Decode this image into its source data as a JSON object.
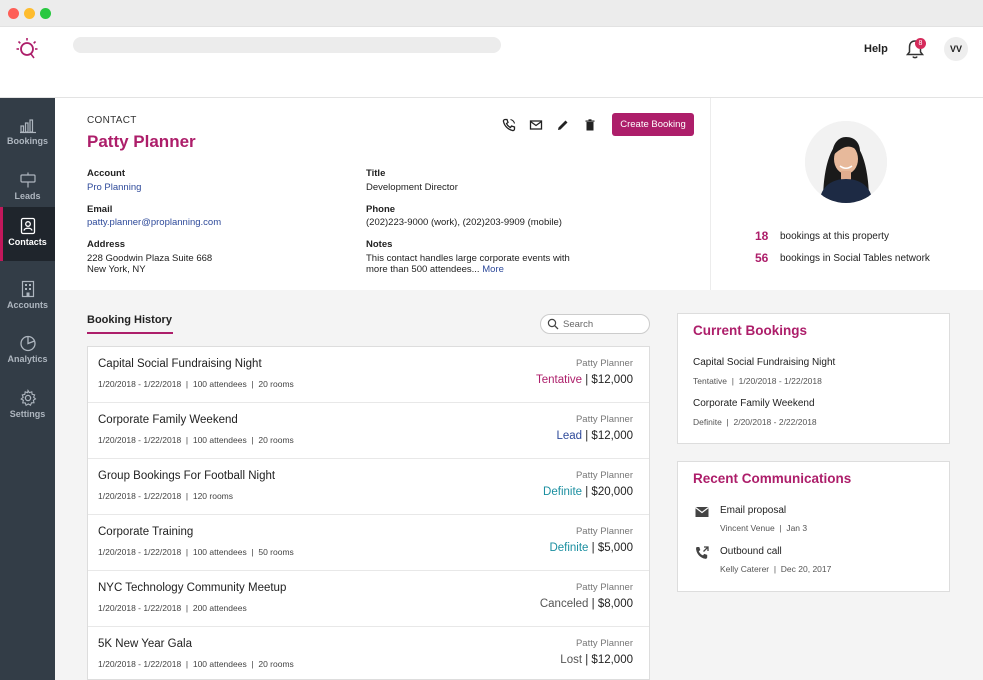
{
  "topbar": {
    "help": "Help",
    "notif_count": "8",
    "avatar_initials": "VV"
  },
  "sidebar": {
    "items": [
      {
        "label": "Bookings",
        "icon": "bar-chart-icon"
      },
      {
        "label": "Leads",
        "icon": "sign-icon"
      },
      {
        "label": "Contacts",
        "icon": "contact-card-icon",
        "active": true
      },
      {
        "label": "Accounts",
        "icon": "building-icon"
      },
      {
        "label": "Analytics",
        "icon": "pie-chart-icon"
      },
      {
        "label": "Settings",
        "icon": "gear-icon"
      }
    ]
  },
  "contact": {
    "kind": "CONTACT",
    "name": "Patty Planner",
    "create_label": "Create Booking",
    "account_label": "Account",
    "account": "Pro Planning",
    "title_label": "Title",
    "title": "Development Director",
    "email_label": "Email",
    "email": "patty.planner@proplanning.com",
    "phone_label": "Phone",
    "phone": "(202)223-9000 (work), (202)203-9909 (mobile)",
    "address_label": "Address",
    "address_line1": "228 Goodwin Plaza Suite 668",
    "address_line2": "New York, NY",
    "notes_label": "Notes",
    "notes_line1": "This contact handles large corporate events with",
    "notes_line2": "more than 500 attendees...",
    "notes_more": "More"
  },
  "stats": {
    "property_count": "18",
    "property_text": "bookings at this property",
    "network_count": "56",
    "network_text": "bookings in Social Tables network"
  },
  "booking_history": {
    "tab_label": "Booking History",
    "search_placeholder": "Search",
    "rows": [
      {
        "title": "Capital Social Fundraising Night",
        "meta": "1/20/2018 - 1/22/2018  |  100 attendees  |  20 rooms",
        "owner": "Patty Planner",
        "status": "Tentative",
        "amount": " | $12,000",
        "color": "#ad1e6a"
      },
      {
        "title": "Corporate Family Weekend",
        "meta": "1/20/2018 - 1/22/2018  |  100 attendees  |  20 rooms",
        "owner": "Patty Planner",
        "status": "Lead",
        "amount": " | $12,000",
        "color": "#2e4a9a"
      },
      {
        "title": "Group Bookings For Football Night",
        "meta": "1/20/2018 - 1/22/2018  |  120 rooms",
        "owner": "Patty Planner",
        "status": "Definite",
        "amount": " | $20,000",
        "color": "#1b8fa0"
      },
      {
        "title": "Corporate Training",
        "meta": "1/20/2018 - 1/22/2018  |  100 attendees  |  50 rooms",
        "owner": "Patty Planner",
        "status": "Definite",
        "amount": " | $5,000",
        "color": "#1b8fa0"
      },
      {
        "title": "NYC Technology Community Meetup",
        "meta": "1/20/2018 - 1/22/2018  |  200 attendees",
        "owner": "Patty Planner",
        "status": "Canceled",
        "amount": " | $8,000",
        "color": "#555555"
      },
      {
        "title": "5K New Year Gala",
        "meta": "1/20/2018 - 1/22/2018  |  100 attendees  |  20 rooms",
        "owner": "Patty Planner",
        "status": "Lost",
        "amount": " | $12,000",
        "color": "#555555"
      }
    ]
  },
  "current_bookings": {
    "title": "Current Bookings",
    "items": [
      {
        "title": "Capital Social Fundraising Night",
        "meta": "Tentative  |  1/20/2018 - 1/22/2018"
      },
      {
        "title": "Corporate Family Weekend",
        "meta": "Definite  |  2/20/2018 - 2/22/2018"
      }
    ]
  },
  "recent_comms": {
    "title": "Recent Communications",
    "items": [
      {
        "title": "Email proposal",
        "meta": "Vincent Venue  |  Jan 3",
        "icon": "mail-icon"
      },
      {
        "title": "Outbound call",
        "meta": "Kelly Caterer  |  Dec 20, 2017",
        "icon": "outbound-call-icon"
      }
    ]
  }
}
